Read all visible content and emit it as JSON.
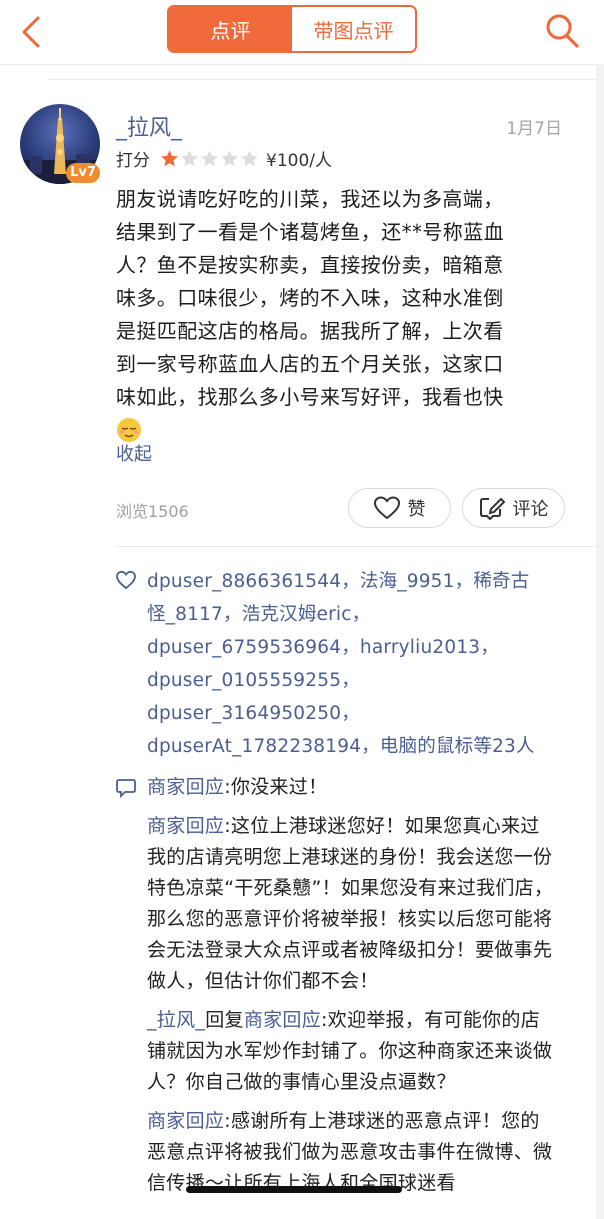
{
  "header": {
    "tabs": [
      {
        "label": "点评",
        "active": true
      },
      {
        "label": "带图点评",
        "active": false
      }
    ],
    "accent_color": "#f0693a"
  },
  "review": {
    "username": "_拉风_",
    "level": "Lv7",
    "date": "1月7日",
    "rating_label": "打分",
    "rating_stars": 1,
    "rating_max": 5,
    "price": "¥100/人",
    "lines": [
      "朋友说请吃好吃的川菜，我还以为多高端，",
      "结果到了一看是个诸葛烤鱼，还**号称蓝血",
      "人？鱼不是按实称卖，直接按份卖，暗箱意",
      "味多。口味很少，烤的不入味，这种水准倒",
      "是挺匹配这店的格局。据我所了解，上次看",
      "到一家号称蓝血人店的五个月关张，这家口",
      "味如此，找那么多小号来写好评，我看也快"
    ],
    "collapse_label": "收起",
    "views": "浏览1506",
    "like_label": "赞",
    "comment_label": "评论"
  },
  "likes": {
    "line1": "dpuser_8866361544，法海_9951，稀奇古",
    "line2": "怪_8117，浩克汉姆eric，",
    "line3": "dpuser_6759536964，harryliu2013，",
    "line4": "dpuser_0105559255，",
    "line5": "dpuser_3164950250，",
    "line6a": "dpuserAt_1782238194，",
    "line6b": "电脑的鼠标等23人"
  },
  "replies": {
    "r1_name": "商家回应",
    "r1_text": ":你没来过！",
    "r2_name": "商家回应",
    "r2_text": ":这位上港球迷您好！如果您真心来过我的店请亮明您上港球迷的身份！我会送您一份特色凉菜“干死桑戆”！如果您没有来过我们店，那么您的恶意评价将被举报！核实以后您可能将会无法登录大众点评或者被降级扣分！要做事先做人，但估计你们都不会！",
    "r3_name": "_拉风_",
    "r3_mid": "回复",
    "r3_name2": "商家回应",
    "r3_text": ":欢迎举报，有可能你的店铺就因为水军炒作封铺了。你这种商家还来谈做人？你自己做的事情心里没点逼数？",
    "r4_name": "商家回应",
    "r4_text": ":感谢所有上港球迷的恶意点评！您的恶意点评将被我们做为恶意攻击事件在微博、微信传播～让所有上海人和全国球迷看"
  }
}
